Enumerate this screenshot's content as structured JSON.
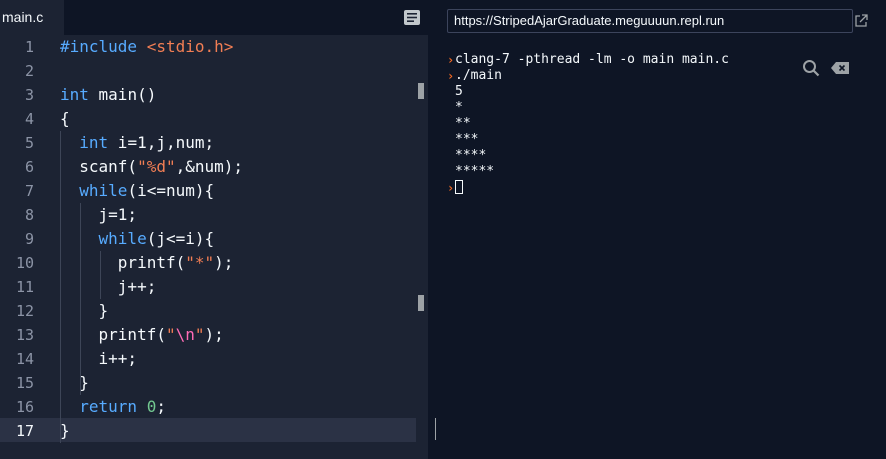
{
  "editor": {
    "tab_label": "main.c",
    "active_line": 17,
    "line_numbers": [
      "1",
      "2",
      "3",
      "4",
      "5",
      "6",
      "7",
      "8",
      "9",
      "10",
      "11",
      "12",
      "13",
      "14",
      "15",
      "16",
      "17"
    ],
    "lines": [
      [
        {
          "t": "#include ",
          "c": "kw"
        },
        {
          "t": "<stdio.h>",
          "c": "str"
        }
      ],
      [],
      [
        {
          "t": "int",
          "c": "kw"
        },
        {
          "t": " main()",
          "c": "p"
        }
      ],
      [
        {
          "t": "{",
          "c": "p"
        }
      ],
      [
        {
          "t": "  ",
          "c": "p"
        },
        {
          "t": "int",
          "c": "kw"
        },
        {
          "t": " i=1,j,num;",
          "c": "p"
        }
      ],
      [
        {
          "t": "  scanf(",
          "c": "p"
        },
        {
          "t": "\"%d\"",
          "c": "str"
        },
        {
          "t": ",&num);",
          "c": "p"
        }
      ],
      [
        {
          "t": "  ",
          "c": "p"
        },
        {
          "t": "while",
          "c": "kw"
        },
        {
          "t": "(i<=num){",
          "c": "p"
        }
      ],
      [
        {
          "t": "    j=1;",
          "c": "p"
        }
      ],
      [
        {
          "t": "    ",
          "c": "p"
        },
        {
          "t": "while",
          "c": "kw"
        },
        {
          "t": "(j<=i){",
          "c": "p"
        }
      ],
      [
        {
          "t": "      printf(",
          "c": "p"
        },
        {
          "t": "\"*\"",
          "c": "str"
        },
        {
          "t": ");",
          "c": "p"
        }
      ],
      [
        {
          "t": "      j++;",
          "c": "p"
        }
      ],
      [
        {
          "t": "    }",
          "c": "p"
        }
      ],
      [
        {
          "t": "    printf(",
          "c": "p"
        },
        {
          "t": "\"",
          "c": "str"
        },
        {
          "t": "\\n",
          "c": "esc"
        },
        {
          "t": "\"",
          "c": "str"
        },
        {
          "t": ");",
          "c": "p"
        }
      ],
      [
        {
          "t": "    i++;",
          "c": "p"
        }
      ],
      [
        {
          "t": "  }",
          "c": "p"
        }
      ],
      [
        {
          "t": "  ",
          "c": "p"
        },
        {
          "t": "return",
          "c": "kw"
        },
        {
          "t": " ",
          "c": "p"
        },
        {
          "t": "0",
          "c": "num"
        },
        {
          "t": ";",
          "c": "p"
        }
      ],
      [
        {
          "t": "}",
          "c": "p"
        }
      ]
    ]
  },
  "console": {
    "url": "https://StripedAjarGraduate.meguuuun.repl.run",
    "lines": [
      {
        "prompt": true,
        "text": "clang-7 -pthread -lm -o main main.c"
      },
      {
        "prompt": true,
        "text": "./main"
      },
      {
        "prompt": false,
        "text": "5"
      },
      {
        "prompt": false,
        "text": "*"
      },
      {
        "prompt": false,
        "text": "**"
      },
      {
        "prompt": false,
        "text": "***"
      },
      {
        "prompt": false,
        "text": "****"
      },
      {
        "prompt": false,
        "text": "*****"
      },
      {
        "prompt": true,
        "text": "",
        "cursor": true
      }
    ],
    "prompt_glyph": "›"
  },
  "colors": {
    "editor_bg": "#1c2333",
    "console_bg": "#0e1525",
    "keyword": "#57abff",
    "string": "#f27e54",
    "escape": "#ff6bb5",
    "number": "#73c991",
    "prompt": "#f26822"
  },
  "icons": {
    "tab_menu": "menu-icon",
    "open": "open-in-new-tab-icon",
    "search": "search-icon",
    "clear": "clear-console-icon"
  }
}
